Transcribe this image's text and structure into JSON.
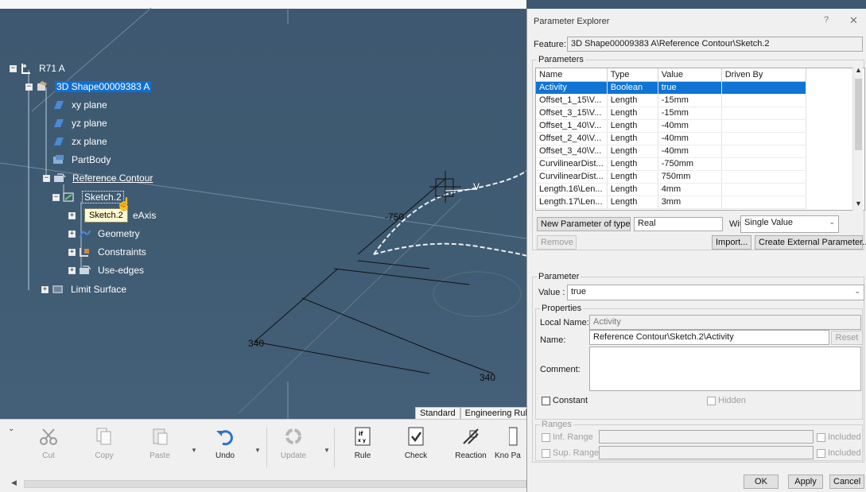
{
  "tree": {
    "root": {
      "label": "R71 A"
    },
    "items": [
      {
        "label": "3D Shape00009383 A"
      },
      {
        "label": "xy plane"
      },
      {
        "label": "yz plane"
      },
      {
        "label": "zx plane"
      },
      {
        "label": "PartBody"
      },
      {
        "label": "Reference Contour"
      },
      {
        "label": "Sketch.2"
      },
      {
        "label": "eAxis"
      },
      {
        "label": "Geometry"
      },
      {
        "label": "Constraints"
      },
      {
        "label": "Use-edges"
      },
      {
        "label": "Limit Surface"
      }
    ],
    "tooltip": "Sketch.2"
  },
  "scene": {
    "dims": [
      "-750",
      "340",
      "340"
    ],
    "axis_v": "V"
  },
  "toolbar": {
    "tabs": [
      "Standard",
      "Engineering Rules"
    ],
    "buttons": [
      {
        "label": "Cut",
        "icon": "scissors-icon"
      },
      {
        "label": "Copy",
        "icon": "copy-icon"
      },
      {
        "label": "Paste",
        "icon": "paste-icon"
      },
      {
        "label": "Undo",
        "icon": "undo-icon"
      },
      {
        "label": "Update",
        "icon": "update-icon"
      },
      {
        "label": "Rule",
        "icon": "rule-icon"
      },
      {
        "label": "Check",
        "icon": "check-icon"
      },
      {
        "label": "Reaction",
        "icon": "reaction-icon"
      },
      {
        "label": "Kno Pa",
        "icon": "knowledge-icon"
      }
    ]
  },
  "dialog": {
    "title": "Parameter Explorer",
    "help": "?",
    "close": "✕",
    "feature_label": "Feature:",
    "feature_value": "3D Shape00009383 A\\Reference Contour\\Sketch.2",
    "parameters_legend": "Parameters",
    "columns": [
      "Name",
      "Type",
      "Value",
      "Driven By"
    ],
    "rows": [
      {
        "name": "Activity",
        "type": "Boolean",
        "value": "true",
        "driven": ""
      },
      {
        "name": "Offset_1_15\\V...",
        "type": "Length",
        "value": "-15mm",
        "driven": ""
      },
      {
        "name": "Offset_3_15\\V...",
        "type": "Length",
        "value": "-15mm",
        "driven": ""
      },
      {
        "name": "Offset_1_40\\V...",
        "type": "Length",
        "value": "-40mm",
        "driven": ""
      },
      {
        "name": "Offset_2_40\\V...",
        "type": "Length",
        "value": "-40mm",
        "driven": ""
      },
      {
        "name": "Offset_3_40\\V...",
        "type": "Length",
        "value": "-40mm",
        "driven": ""
      },
      {
        "name": "CurvilinearDist...",
        "type": "Length",
        "value": "-750mm",
        "driven": ""
      },
      {
        "name": "CurvilinearDist...",
        "type": "Length",
        "value": "750mm",
        "driven": ""
      },
      {
        "name": "Length.16\\Len...",
        "type": "Length",
        "value": "4mm",
        "driven": ""
      },
      {
        "name": "Length.17\\Len...",
        "type": "Length",
        "value": "3mm",
        "driven": ""
      }
    ],
    "new_param_label": "New Parameter of type",
    "new_param_type": "Real",
    "with_label": "With",
    "with_value": "Single Value",
    "remove": "Remove",
    "import": "Import...",
    "create_external": "Create External Parameter...",
    "parameter_legend": "Parameter",
    "value_label": "Value :",
    "value_value": "true",
    "properties_legend": "Properties",
    "local_name_label": "Local Name:",
    "local_name_value": "Activity",
    "name_label": "Name:",
    "name_value": "Reference Contour\\Sketch.2\\Activity",
    "reset": "Reset",
    "comment_label": "Comment:",
    "comment_value": "",
    "constant": "Constant",
    "hidden": "Hidden",
    "ranges_legend": "Ranges",
    "inf_range": "Inf. Range",
    "sup_range": "Sup. Range",
    "included": "Included",
    "ok": "OK",
    "apply": "Apply",
    "cancel": "Cancel"
  }
}
